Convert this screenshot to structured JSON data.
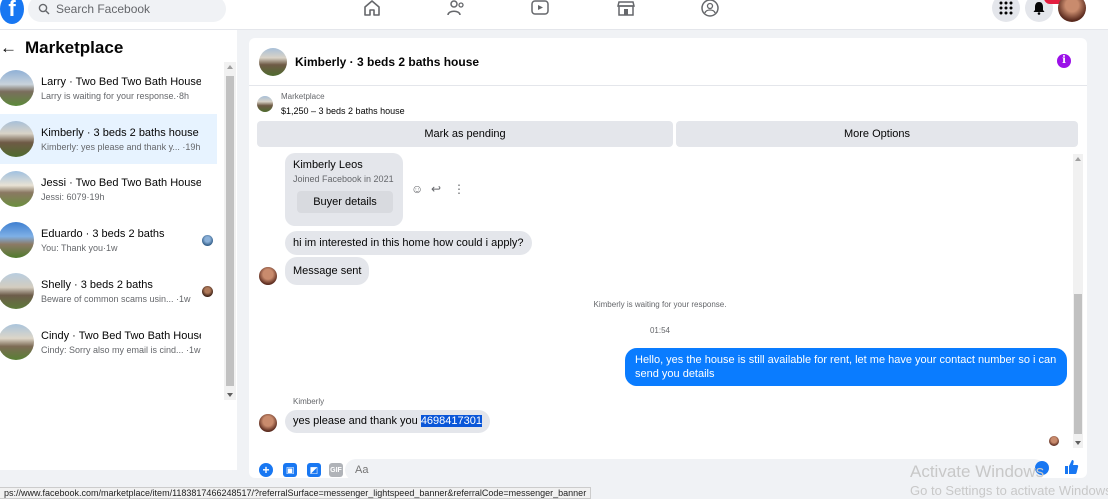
{
  "topbar": {
    "logo": "f",
    "search_placeholder": "Search Facebook",
    "colors": {
      "brand": "#1877f2",
      "badge": "#e41e3f"
    }
  },
  "sidebar": {
    "title": "Marketplace",
    "back_icon": "arrow-left-icon",
    "conversations": [
      {
        "name": "Larry · Two Bed Two Bath House",
        "preview": "Larry is waiting for your response.·8h",
        "active": false
      },
      {
        "name": "Kimberly · 3 beds 2 baths house",
        "preview": "Kimberly: yes please and thank y... ·19h",
        "active": true
      },
      {
        "name": "Jessi · Two Bed Two Bath House",
        "preview": "Jessi: 6079·19h",
        "active": false
      },
      {
        "name": "Eduardo · 3 beds 2 baths",
        "preview": "You: Thank you·1w",
        "active": false
      },
      {
        "name": "Shelly · 3 beds 2 baths",
        "preview": "Beware of common scams usin... ·1w",
        "active": false
      },
      {
        "name": "Cindy · Two Bed Two Bath House",
        "preview": "Cindy: Sorry also my email is cind... ·1w",
        "active": false
      }
    ]
  },
  "chat": {
    "header_title": "Kimberly · 3 beds 2 baths house",
    "info_label": "i",
    "listing_source": "Marketplace",
    "listing_price": "$1,250 – 3 beds 2 baths house",
    "mark_pending_label": "Mark as pending",
    "more_options_label": "More Options",
    "buyer_name": "Kimberly Leos",
    "buyer_joined": "Joined Facebook in 2021",
    "buyer_details_label": "Buyer details",
    "msg_interest": "hi im interested in this home how could i apply?",
    "msg_sent": "Message sent",
    "system_waiting": "Kimberly is waiting for your response.",
    "timestamp": "01:54",
    "msg_outgoing": "Hello, yes the house is still available for rent, let me have your contact number so i can send you details",
    "sender_label": "Kimberly",
    "msg_reply_text": "yes please and thank you ",
    "msg_reply_number": "4698417301",
    "composer_placeholder": "Aa",
    "gif_label": "GIF",
    "colors": {
      "outgoing_bubble": "#0a7cff",
      "info": "#9b10e8",
      "highlight": "#0a56d8"
    }
  },
  "status_url": "ps://www.facebook.com/marketplace/item/1183817466248517/?referralSurface=messenger_lightspeed_banner&referralCode=messenger_banner",
  "watermark": {
    "line1": "Activate Windows",
    "line2": "Go to Settings to activate Windows."
  }
}
